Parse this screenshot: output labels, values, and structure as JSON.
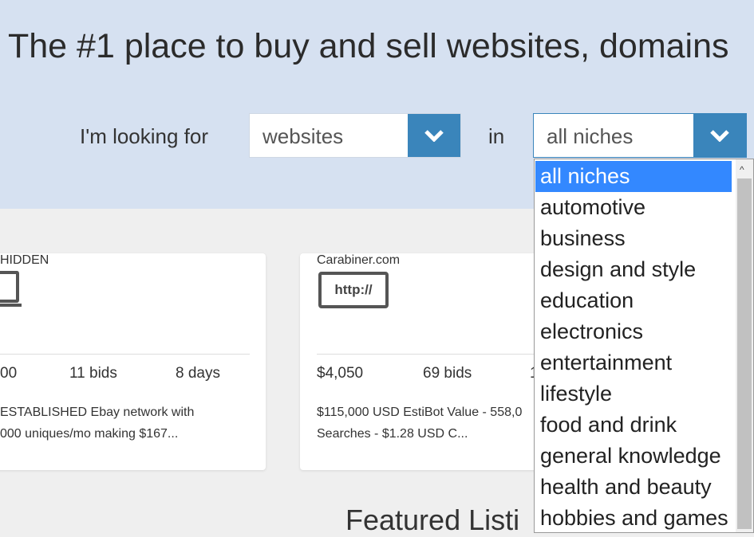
{
  "hero": {
    "title": "The #1 place to buy and sell websites, domains",
    "looking_for": "I'm looking for",
    "type_select": "websites",
    "in": "in",
    "niche_select": "all niches"
  },
  "cards": [
    {
      "name": "HIDDEN",
      "price": "00",
      "bids": "11 bids",
      "time": "8 days",
      "desc1": "ESTABLISHED Ebay network with",
      "desc2": "000 uniques/mo making $167..."
    },
    {
      "icon_text": "http://",
      "name": "Carabiner.com",
      "price": "$4,050",
      "bids": "69 bids",
      "time": "1",
      "desc1": "$115,000 USD EstiBot Value - 558,0",
      "desc2": "Searches - $1.28 USD C..."
    }
  ],
  "featured": "Featured Listi",
  "dropdown": {
    "options": [
      "all niches",
      "automotive",
      "business",
      "design and style",
      "education",
      "electronics",
      "entertainment",
      "lifestyle",
      "food and drink",
      "general knowledge",
      "health and beauty",
      "hobbies and games"
    ],
    "selected": "all niches"
  },
  "colors": {
    "hero_bg": "#d6e1f1",
    "accent": "#3a85bb",
    "link": "#3a8fc9",
    "highlight": "#3388ff"
  }
}
